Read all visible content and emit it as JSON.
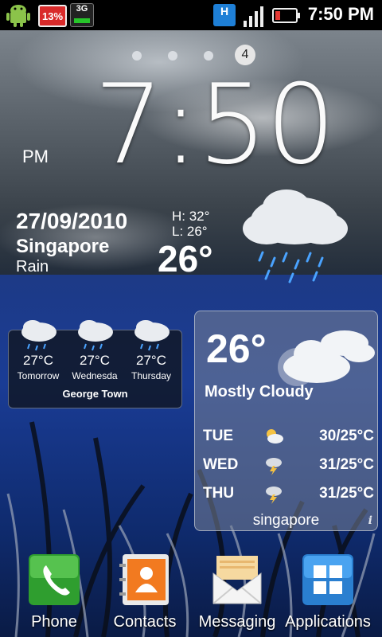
{
  "status_bar": {
    "battery_percent": "13%",
    "network_type": "3G",
    "hspa_label": "H",
    "time": "7:50 PM",
    "icons": [
      "android-icon",
      "battery-percent-icon",
      "3g-icon",
      "hspa-icon",
      "signal-icon",
      "battery-icon"
    ]
  },
  "home": {
    "current_page": "4",
    "page_count": 4
  },
  "clock": {
    "time": "7:50",
    "ampm": "PM"
  },
  "weather_main": {
    "date": "27/09/2010",
    "city": "Singapore",
    "condition": "Rain",
    "high": "H:  32°",
    "low": "L:  26°",
    "temperature": "26°",
    "icon": "rain-cloud-icon"
  },
  "forecast_widget": {
    "days": [
      {
        "temp": "27°C",
        "day": "Tomorrow",
        "icon": "rain-cloud-icon"
      },
      {
        "temp": "27°C",
        "day": "Wednesda",
        "icon": "rain-cloud-icon"
      },
      {
        "temp": "27°C",
        "day": "Thursday",
        "icon": "rain-cloud-icon"
      }
    ],
    "location": "George Town"
  },
  "weather_widget": {
    "temperature": "26°",
    "condition": "Mostly Cloudy",
    "forecast": [
      {
        "day": "TUE",
        "range": "30/25°C",
        "icon": "partly-cloudy-icon"
      },
      {
        "day": "WED",
        "range": "31/25°C",
        "icon": "thunderstorm-icon"
      },
      {
        "day": "THU",
        "range": "31/25°C",
        "icon": "thunderstorm-icon"
      }
    ],
    "city": "singapore",
    "info_label": "i"
  },
  "dock": {
    "items": [
      {
        "label": "Phone",
        "color": "#2f9e2f"
      },
      {
        "label": "Contacts",
        "color": "#f27a20"
      },
      {
        "label": "Messaging",
        "color": "#f3c46a"
      },
      {
        "label": "Applications",
        "color": "#2a7fd0"
      }
    ]
  }
}
